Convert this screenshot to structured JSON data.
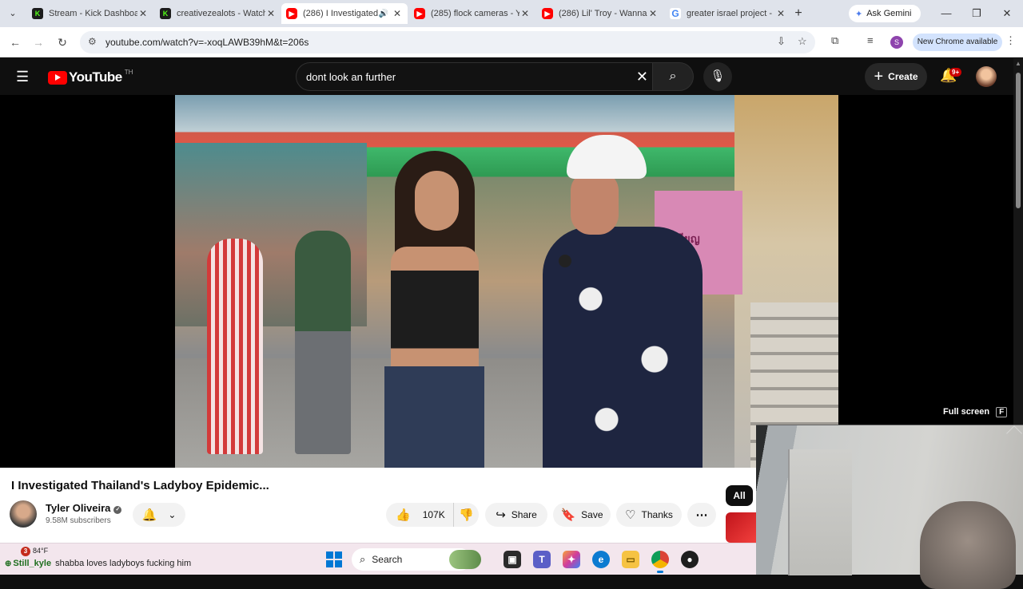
{
  "browser": {
    "tabs": [
      {
        "title": "Stream - Kick Dashboa",
        "favicon": "kick",
        "active": false
      },
      {
        "title": "creativezealots - Watch",
        "favicon": "kick",
        "active": false
      },
      {
        "title": "(286) I Investigated",
        "favicon": "youtube",
        "active": true,
        "audio": true
      },
      {
        "title": "(285) flock cameras - Y",
        "favicon": "youtube",
        "active": false
      },
      {
        "title": "(286) Lil' Troy - Wanna",
        "favicon": "youtube",
        "active": false
      },
      {
        "title": "greater israel project -",
        "favicon": "google",
        "active": false
      }
    ],
    "gemini_label": "Ask Gemini",
    "url": "youtube.com/watch?v=-xoqLAWB39hM&t=206s",
    "profile_initial": "S",
    "update_label": "New Chrome available"
  },
  "youtube": {
    "logo_text": "YouTube",
    "country_code": "TH",
    "search_query": "dont look an further",
    "create_label": "Create",
    "notif_count": "9+",
    "fullscreen_label": "Full screen",
    "fullscreen_key": "F",
    "video_sign_text": "เหรียญ",
    "video_title": "I Investigated Thailand's Ladyboy Epidemic...",
    "channel_name": "Tyler Oliveira",
    "subscribers": "9.58M subscribers",
    "like_count": "107K",
    "share_label": "Share",
    "save_label": "Save",
    "thanks_label": "Thanks",
    "chip_all": "All"
  },
  "taskbar": {
    "weather_badge": "3",
    "temperature": "84°F",
    "chat_user": "Still_kyle",
    "chat_message": "shabba loves ladyboys fucking him",
    "search_label": "Search"
  },
  "colors": {
    "youtube_red": "#ff0000",
    "dark_bg": "#0f0f0f",
    "tabstrip": "#dfe3eb",
    "taskbar": "#f3e6ed"
  }
}
